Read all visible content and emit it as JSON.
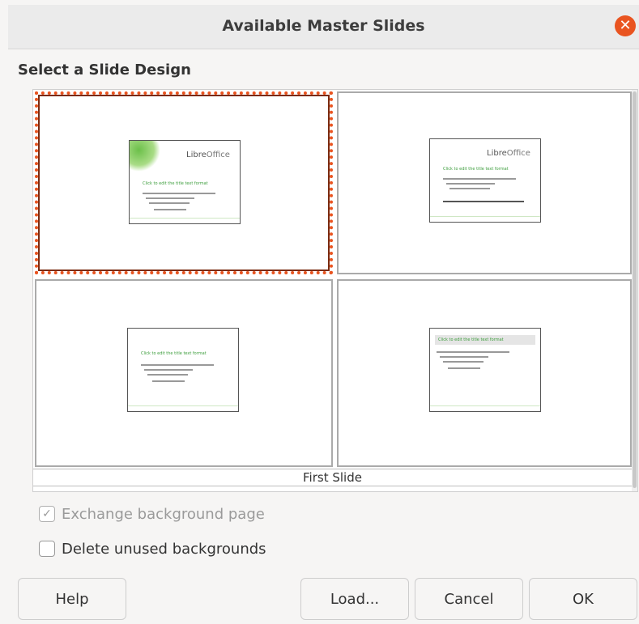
{
  "window": {
    "title": "Available Master Slides"
  },
  "section": {
    "label": "Select a Slide Design"
  },
  "slides": [
    {
      "logo_prefix": "Libre",
      "logo_suffix": "Office",
      "title_text": "Click to edit the title text format",
      "outline_text": "Click to edit the outline text format",
      "second_level": "Second Outline Level",
      "third_level": "Third Outline Level"
    },
    {
      "logo_prefix": "Libre",
      "logo_suffix": "Office",
      "title_text": "Click to edit the title text format",
      "outline_text": "Click to edit the outline text format",
      "second_level": "Second Outline Level",
      "third_level": "Third Outline Level"
    },
    {
      "title_text": "Click to edit the title text format",
      "outline_text": "Click to edit the outline text format",
      "second_level": "Second Outline Level",
      "third_level": "Third Outline Level"
    },
    {
      "title_text": "Click to edit the title text format",
      "outline_text": "Click to edit the outline text format",
      "second_level": "Second Outline Level",
      "third_level": "Third Outline Level"
    }
  ],
  "caption": "First Slide",
  "options": {
    "exchange": {
      "label": "Exchange background page",
      "checked": true,
      "disabled": true
    },
    "delete_unused": {
      "label": "Delete unused backgrounds",
      "checked": false
    }
  },
  "buttons": {
    "help": "Help",
    "load": "Load...",
    "cancel": "Cancel",
    "ok": "OK"
  },
  "colors": {
    "accent": "#e95420"
  }
}
